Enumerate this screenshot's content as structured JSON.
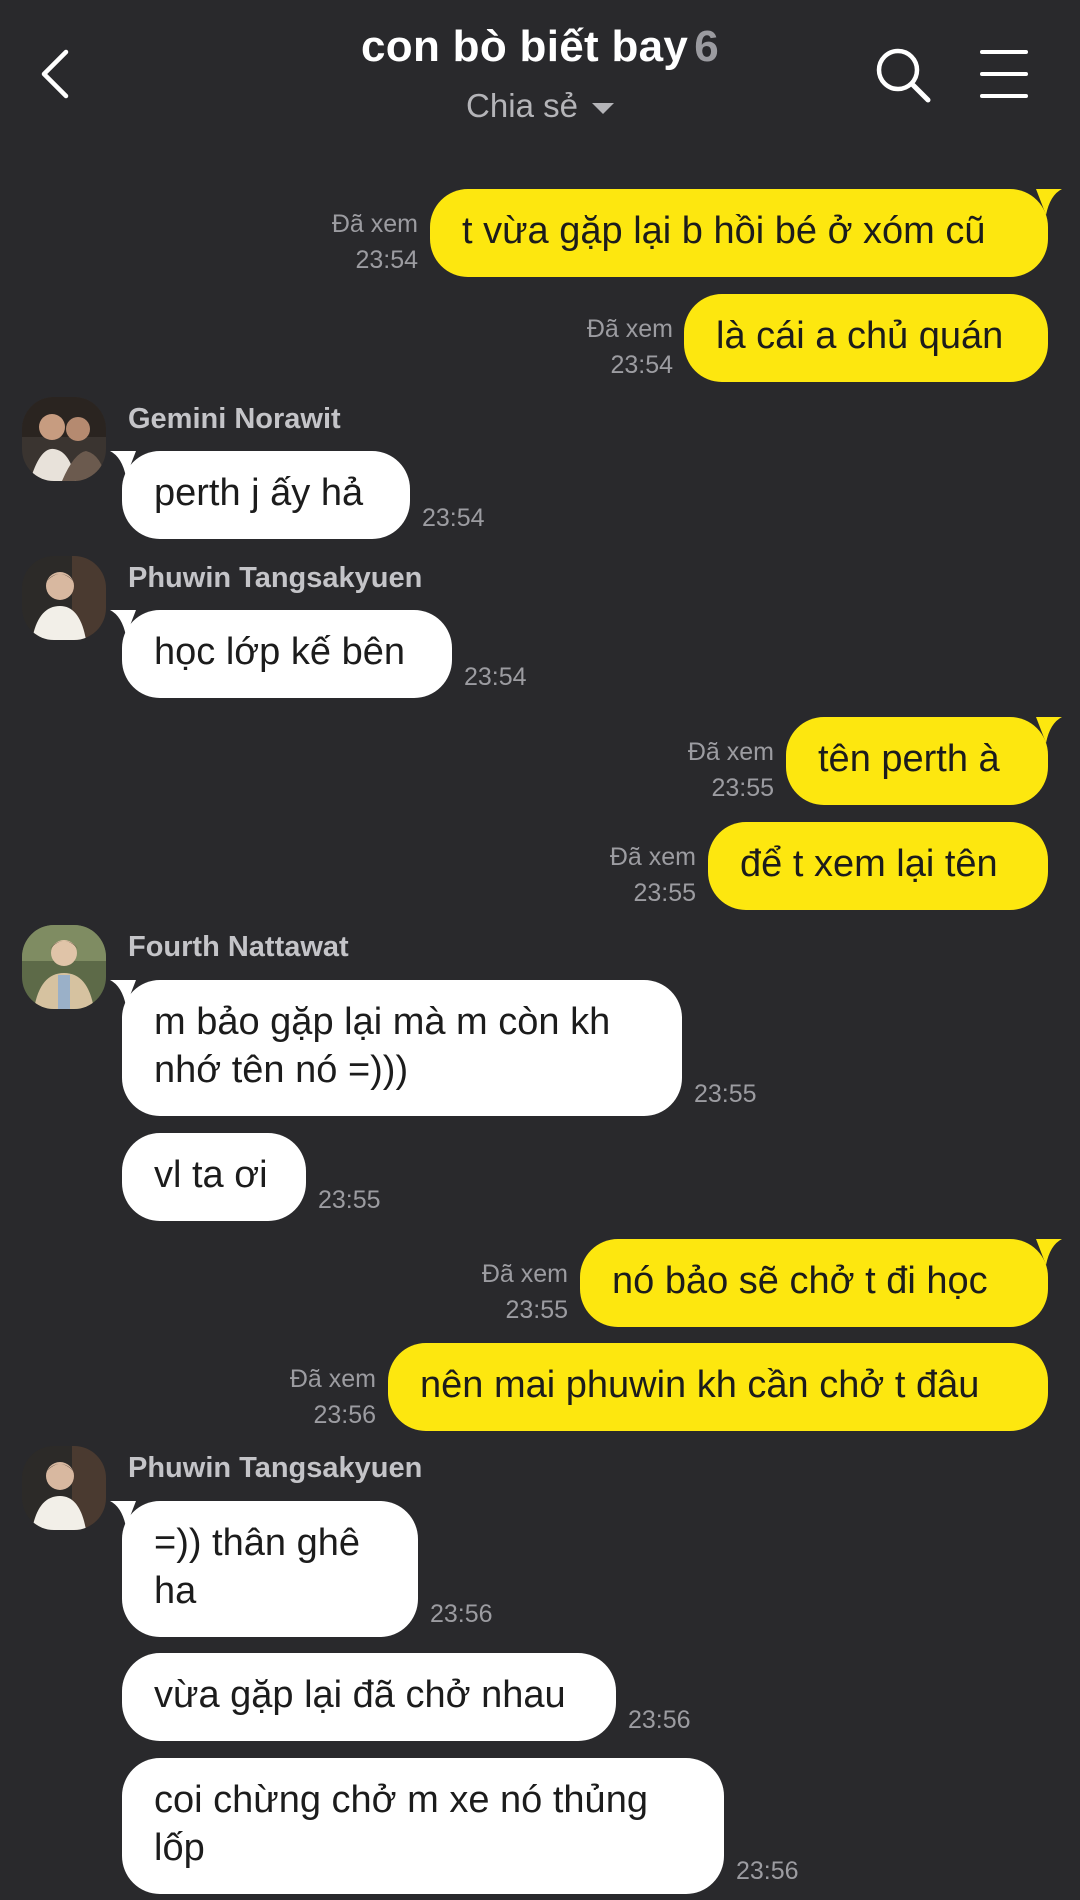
{
  "header": {
    "title": "con bò biết bay",
    "member_count": "6",
    "subtitle": "Chia sẻ"
  },
  "icons": {
    "back": "chevron-left-icon",
    "search": "search-icon",
    "menu": "hamburger-menu-icon",
    "dropdown": "caret-down-icon"
  },
  "colors": {
    "background": "#29292c",
    "outgoing_bubble": "#fde70f",
    "incoming_bubble": "#ffffff",
    "meta_text": "#9c9ca1"
  },
  "messages": [
    {
      "dir": "out",
      "text": "t vừa gặp lại b hồi bé ở xóm cũ",
      "status": "Đã xem",
      "time": "23:54"
    },
    {
      "dir": "out",
      "text": "là cái a chủ quán",
      "status": "Đã xem",
      "time": "23:54"
    },
    {
      "dir": "in",
      "sender": "Gemini Norawit",
      "text": "perth j ấy hả",
      "time": "23:54"
    },
    {
      "dir": "in",
      "sender": "Phuwin Tangsakyuen",
      "text": "học lớp kế bên",
      "time": "23:54"
    },
    {
      "dir": "out",
      "text": "tên perth à",
      "status": "Đã xem",
      "time": "23:55"
    },
    {
      "dir": "out",
      "text": "để t xem lại tên",
      "status": "Đã xem",
      "time": "23:55"
    },
    {
      "dir": "in",
      "sender": "Fourth Nattawat",
      "text": "m bảo gặp lại mà m còn kh nhớ tên nó =)))",
      "time": "23:55"
    },
    {
      "dir": "in",
      "text": "vl ta ơi",
      "time": "23:55"
    },
    {
      "dir": "out",
      "text": "nó bảo sẽ chở t đi học",
      "status": "Đã xem",
      "time": "23:55"
    },
    {
      "dir": "out",
      "text": "nên mai phuwin kh cần chở t đâu",
      "status": "Đã xem",
      "time": "23:56"
    },
    {
      "dir": "in",
      "sender": "Phuwin Tangsakyuen",
      "text": "=)) thân ghê ha",
      "time": "23:56"
    },
    {
      "dir": "in",
      "text": "vừa gặp lại đã chở nhau",
      "time": "23:56"
    },
    {
      "dir": "in",
      "text": "coi chừng chở m xe nó thủng lốp",
      "time": "23:56"
    }
  ]
}
